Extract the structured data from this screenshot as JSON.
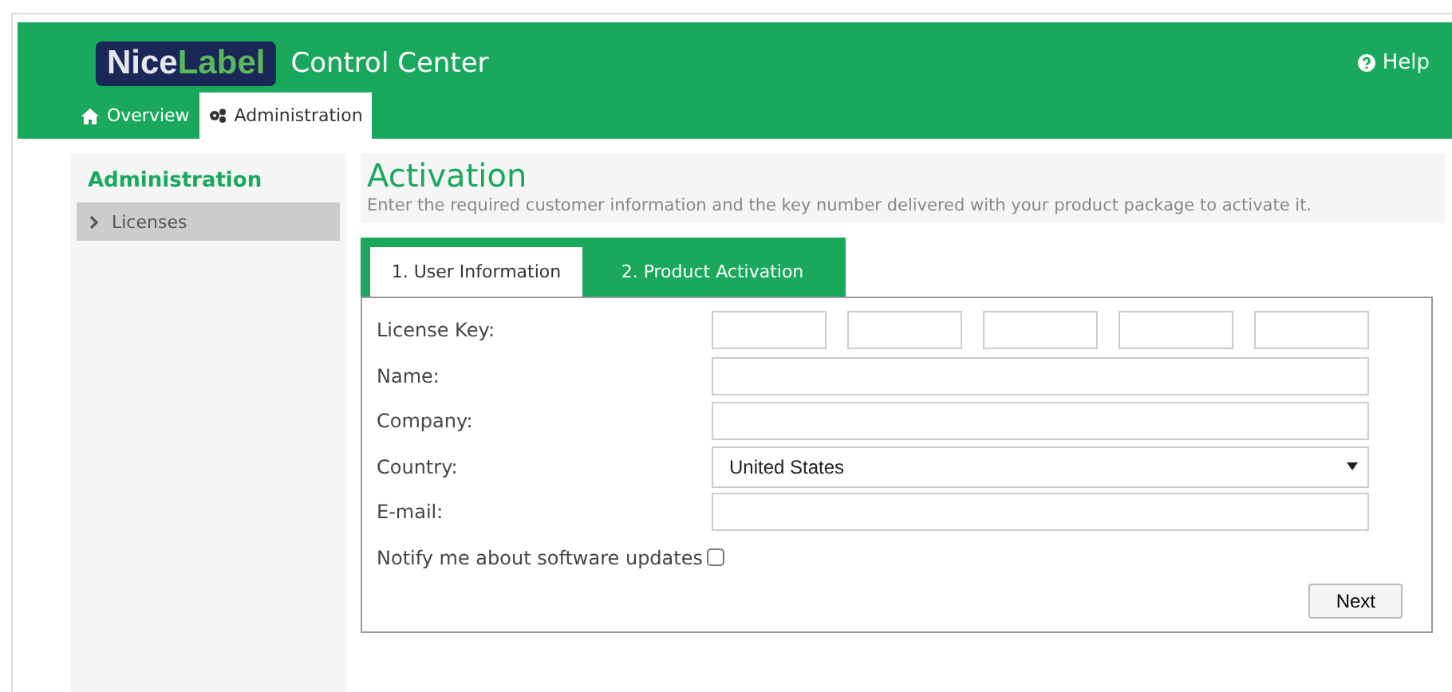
{
  "header": {
    "logo": [
      "Nice",
      "Label"
    ],
    "title": "Control Center",
    "help": "Help"
  },
  "nav_tabs": [
    {
      "label": "Overview",
      "selected": false
    },
    {
      "label": "Administration",
      "selected": true
    }
  ],
  "sidebar": {
    "title": "Administration",
    "items": [
      {
        "label": "Licenses",
        "selected": true
      }
    ]
  },
  "page": {
    "title": "Activation",
    "description": "Enter the required customer information and the key number delivered with your product package to activate it."
  },
  "step_tabs": [
    {
      "label": "1. User Information",
      "selected": true
    },
    {
      "label": "2. Product Activation",
      "selected": false
    }
  ],
  "form": {
    "fields": [
      {
        "label": "License Key:",
        "kind": "key"
      },
      {
        "label": "Name:",
        "kind": "text"
      },
      {
        "label": "Company:",
        "kind": "text"
      },
      {
        "label": "Country:",
        "kind": "select",
        "value": "United States"
      },
      {
        "label": "E-mail:",
        "kind": "text"
      }
    ],
    "notify": {
      "label": "Notify me about software updates",
      "checked": false
    },
    "next": "Next"
  }
}
